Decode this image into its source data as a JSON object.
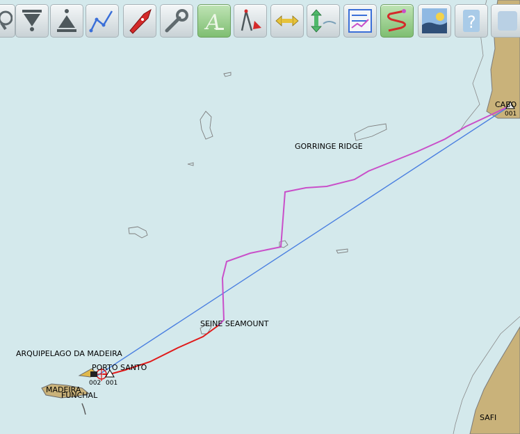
{
  "toolbar": {
    "buttons": [
      {
        "name": "zoom-out-button",
        "icon": "magnifier-icon"
      },
      {
        "name": "zoom-in-scale-down-button",
        "icon": "triangle-down-icon"
      },
      {
        "name": "zoom-in-scale-up-button",
        "icon": "triangle-up-icon"
      },
      {
        "name": "create-route-button",
        "icon": "route-icon"
      },
      {
        "name": "follow-boat-button",
        "icon": "boat-icon"
      },
      {
        "name": "settings-button",
        "icon": "wrench-icon"
      },
      {
        "name": "toggle-text-button",
        "icon": "text-a-icon",
        "active": true
      },
      {
        "name": "tools-button",
        "icon": "compass-divider-icon"
      },
      {
        "name": "horizontal-measure-button",
        "icon": "horizontal-arrows-icon"
      },
      {
        "name": "vertical-measure-button",
        "icon": "vertical-arrows-icon"
      },
      {
        "name": "route-manager-button",
        "icon": "route-manager-icon"
      },
      {
        "name": "track-button",
        "icon": "track-icon"
      },
      {
        "name": "tides-button",
        "icon": "tide-icon"
      },
      {
        "name": "help-button",
        "icon": "help-icon"
      }
    ]
  },
  "chart": {
    "labels": {
      "gorringe": "GORRINGE RIDGE",
      "seine": "SEINE SEAMOUNT",
      "arquipelago": "ARQUIPELAGO DA MADEIRA",
      "porto_santo": "PORTO SANTO",
      "madeira": "MADEIRA",
      "funchal": "FUNCHAL",
      "cabo": "CABO",
      "safi": "SAFI",
      "wp_002": "002",
      "wp_001_start": "001",
      "wp_001_end": "001"
    },
    "colors": {
      "sea": "#d4e9ec",
      "land": "#c9b27a",
      "route": "#4a7fe0",
      "track_magenta": "#c94fc9",
      "track_red": "#e01a1a"
    }
  }
}
